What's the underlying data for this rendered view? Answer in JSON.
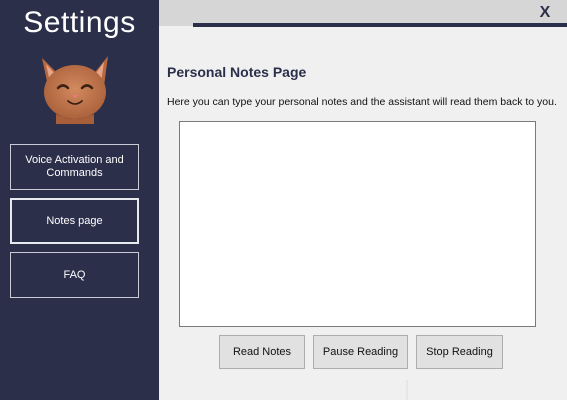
{
  "sidebar": {
    "title": "Settings",
    "avatar_icon": "cat-face-icon",
    "items": [
      {
        "label": "Voice Activation and Commands",
        "active": false
      },
      {
        "label": "Notes page",
        "active": true
      },
      {
        "label": "FAQ",
        "active": false
      }
    ]
  },
  "window": {
    "close_label": "X"
  },
  "notes_page": {
    "title": "Personal Notes Page",
    "description": "Here you can type your personal notes and the assistant will read them back to you.",
    "notes_value": "",
    "buttons": {
      "read": "Read Notes",
      "pause": "Pause Reading",
      "stop": "Stop Reading"
    }
  },
  "colors": {
    "sidebar_bg": "#2b2f4a",
    "main_bg": "#f0f0f0",
    "accent_text": "#2b2f4a"
  }
}
